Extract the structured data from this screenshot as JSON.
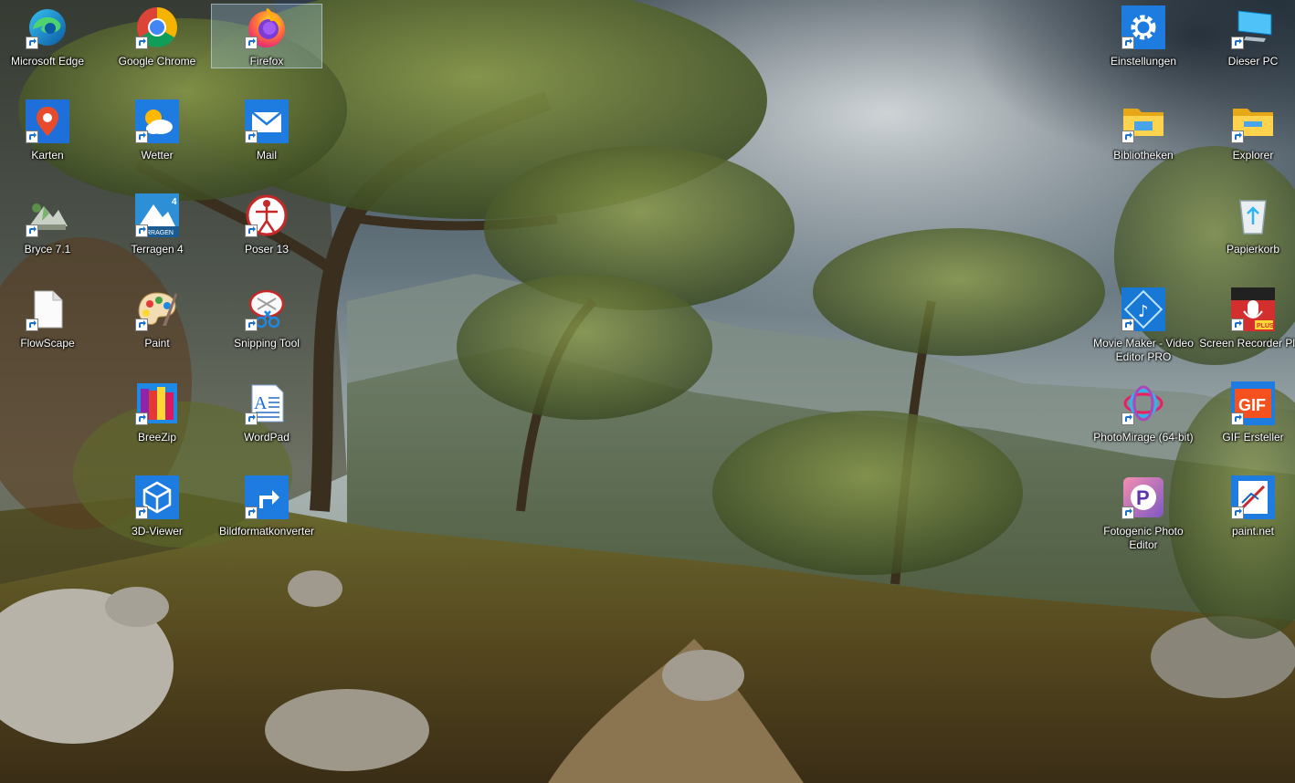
{
  "icons": {
    "edge": {
      "label": "Microsoft Edge",
      "icon": "edge-icon"
    },
    "chrome": {
      "label": "Google Chrome",
      "icon": "chrome-icon"
    },
    "firefox": {
      "label": "Firefox",
      "icon": "firefox-icon",
      "selected": true
    },
    "karten": {
      "label": "Karten",
      "icon": "map-pin-icon"
    },
    "wetter": {
      "label": "Wetter",
      "icon": "weather-icon"
    },
    "mail": {
      "label": "Mail",
      "icon": "mail-icon"
    },
    "bryce": {
      "label": "Bryce 7.1",
      "icon": "bryce-icon"
    },
    "terragen": {
      "label": "Terragen 4",
      "icon": "terragen-icon"
    },
    "poser": {
      "label": "Poser 13",
      "icon": "poser-icon"
    },
    "flowscape": {
      "label": "FlowScape",
      "icon": "file-icon"
    },
    "paint": {
      "label": "Paint",
      "icon": "palette-icon"
    },
    "snipping": {
      "label": "Snipping Tool",
      "icon": "scissors-icon"
    },
    "breezip": {
      "label": "BreeZip",
      "icon": "archive-books-icon"
    },
    "wordpad": {
      "label": "WordPad",
      "icon": "wordpad-icon"
    },
    "viewer3d": {
      "label": "3D-Viewer",
      "icon": "cube-icon"
    },
    "bildformat": {
      "label": "Bildformatkonverter",
      "icon": "arrow-turn-icon"
    },
    "einstellungen": {
      "label": "Einstellungen",
      "icon": "gear-icon"
    },
    "dieserpc": {
      "label": "Dieser PC",
      "icon": "computer-icon"
    },
    "bibliotheken": {
      "label": "Bibliotheken",
      "icon": "folder-icon"
    },
    "explorer": {
      "label": "Explorer",
      "icon": "folder-icon"
    },
    "papierkorb": {
      "label": "Papierkorb",
      "icon": "recycle-bin-icon"
    },
    "moviemaker": {
      "label": "Movie Maker - Video Editor PRO",
      "icon": "film-music-icon"
    },
    "screenrecorder": {
      "label": "Screen Recorder Plus",
      "icon": "microphone-rec-icon"
    },
    "photomirage": {
      "label": "PhotoMirage (64-bit)",
      "icon": "photomirage-icon"
    },
    "gifersteller": {
      "label": "GIF Ersteller",
      "icon": "gif-icon"
    },
    "fotogenic": {
      "label": "Fotogenic  Photo Editor",
      "icon": "fotogenic-p-icon"
    },
    "paintnet": {
      "label": "paint.net",
      "icon": "paintnet-icon"
    }
  },
  "terragen_badge": "4",
  "terragen_banner": "RRAGEN",
  "gif_text": "GIF",
  "recorder_tag": "PLUS",
  "colors": {
    "selection": "#add8ff",
    "label_text": "#ffffff"
  }
}
